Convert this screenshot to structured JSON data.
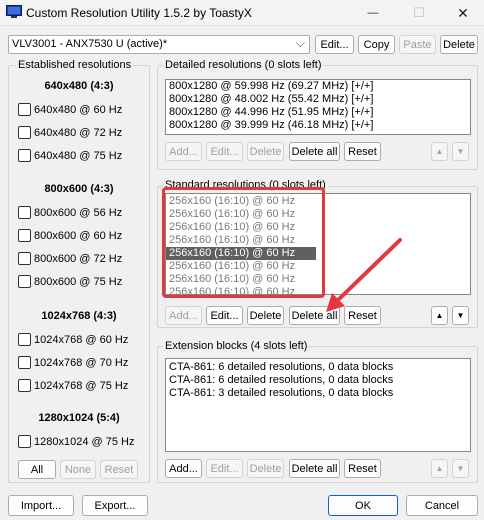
{
  "window": {
    "title": "Custom Resolution Utility 1.5.2 by ToastyX",
    "minimize_glyph": "—",
    "maximize_glyph": "☐",
    "close_glyph": "✕"
  },
  "monitor": {
    "selected": "VLV3001 - ANX7530 U (active)*",
    "edit_label": "Edit...",
    "copy_label": "Copy",
    "paste_label": "Paste",
    "delete_label": "Delete"
  },
  "established": {
    "title": "Established resolutions",
    "sections": [
      {
        "heading": "640x480 (4:3)",
        "items": [
          "640x480 @ 60 Hz",
          "640x480 @ 72 Hz",
          "640x480 @ 75 Hz"
        ]
      },
      {
        "heading": "800x600 (4:3)",
        "items": [
          "800x600 @ 56 Hz",
          "800x600 @ 60 Hz",
          "800x600 @ 72 Hz",
          "800x600 @ 75 Hz"
        ]
      },
      {
        "heading": "1024x768 (4:3)",
        "items": [
          "1024x768 @ 60 Hz",
          "1024x768 @ 70 Hz",
          "1024x768 @ 75 Hz"
        ]
      },
      {
        "heading": "1280x1024 (5:4)",
        "items": [
          "1280x1024 @ 75 Hz"
        ]
      }
    ],
    "all_label": "All",
    "none_label": "None",
    "reset_label": "Reset"
  },
  "detailed": {
    "title": "Detailed resolutions (0 slots left)",
    "rows": [
      "800x1280 @ 59.998 Hz (69.27 MHz) [+/+]",
      "800x1280 @ 48.002 Hz (55.42 MHz) [+/+]",
      "800x1280 @ 44.996 Hz (51.95 MHz) [+/+]",
      "800x1280 @ 39.999 Hz (46.18 MHz) [+/+]"
    ],
    "add_label": "Add...",
    "edit_label": "Edit...",
    "delete_label": "Delete",
    "delete_all_label": "Delete all",
    "reset_label": "Reset"
  },
  "standard": {
    "title": "Standard resolutions (0 slots left)",
    "rows": [
      "256x160 (16:10) @ 60 Hz",
      "256x160 (16:10) @ 60 Hz",
      "256x160 (16:10) @ 60 Hz",
      "256x160 (16:10) @ 60 Hz",
      "256x160 (16:10) @ 60 Hz",
      "256x160 (16:10) @ 60 Hz",
      "256x160 (16:10) @ 60 Hz",
      "256x160 (16:10) @ 60 Hz"
    ],
    "selected_index": 4,
    "add_label": "Add...",
    "edit_label": "Edit...",
    "delete_label": "Delete",
    "delete_all_label": "Delete all",
    "reset_label": "Reset"
  },
  "extension": {
    "title": "Extension blocks (4 slots left)",
    "rows": [
      "CTA-861: 6 detailed resolutions, 0 data blocks",
      "CTA-861: 6 detailed resolutions, 0 data blocks",
      "CTA-861: 3 detailed resolutions, 0 data blocks"
    ],
    "add_label": "Add...",
    "edit_label": "Edit...",
    "delete_label": "Delete",
    "delete_all_label": "Delete all",
    "reset_label": "Reset"
  },
  "footer": {
    "import_label": "Import...",
    "export_label": "Export...",
    "ok_label": "OK",
    "cancel_label": "Cancel"
  },
  "annotation": {
    "color": "#e0393e"
  },
  "icons": {
    "up": "▲",
    "down": "▼",
    "dropdown": "⌵"
  }
}
